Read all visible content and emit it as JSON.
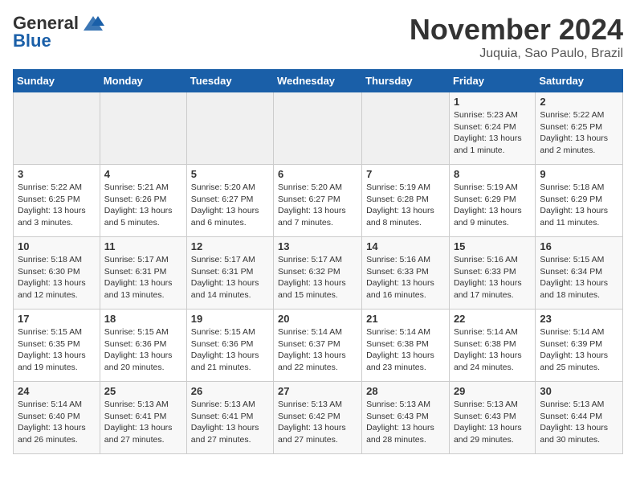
{
  "header": {
    "logo_general": "General",
    "logo_blue": "Blue",
    "month_title": "November 2024",
    "location": "Juquia, Sao Paulo, Brazil"
  },
  "days_of_week": [
    "Sunday",
    "Monday",
    "Tuesday",
    "Wednesday",
    "Thursday",
    "Friday",
    "Saturday"
  ],
  "weeks": [
    [
      {
        "day": "",
        "info": ""
      },
      {
        "day": "",
        "info": ""
      },
      {
        "day": "",
        "info": ""
      },
      {
        "day": "",
        "info": ""
      },
      {
        "day": "",
        "info": ""
      },
      {
        "day": "1",
        "info": "Sunrise: 5:23 AM\nSunset: 6:24 PM\nDaylight: 13 hours and 1 minute."
      },
      {
        "day": "2",
        "info": "Sunrise: 5:22 AM\nSunset: 6:25 PM\nDaylight: 13 hours and 2 minutes."
      }
    ],
    [
      {
        "day": "3",
        "info": "Sunrise: 5:22 AM\nSunset: 6:25 PM\nDaylight: 13 hours and 3 minutes."
      },
      {
        "day": "4",
        "info": "Sunrise: 5:21 AM\nSunset: 6:26 PM\nDaylight: 13 hours and 5 minutes."
      },
      {
        "day": "5",
        "info": "Sunrise: 5:20 AM\nSunset: 6:27 PM\nDaylight: 13 hours and 6 minutes."
      },
      {
        "day": "6",
        "info": "Sunrise: 5:20 AM\nSunset: 6:27 PM\nDaylight: 13 hours and 7 minutes."
      },
      {
        "day": "7",
        "info": "Sunrise: 5:19 AM\nSunset: 6:28 PM\nDaylight: 13 hours and 8 minutes."
      },
      {
        "day": "8",
        "info": "Sunrise: 5:19 AM\nSunset: 6:29 PM\nDaylight: 13 hours and 9 minutes."
      },
      {
        "day": "9",
        "info": "Sunrise: 5:18 AM\nSunset: 6:29 PM\nDaylight: 13 hours and 11 minutes."
      }
    ],
    [
      {
        "day": "10",
        "info": "Sunrise: 5:18 AM\nSunset: 6:30 PM\nDaylight: 13 hours and 12 minutes."
      },
      {
        "day": "11",
        "info": "Sunrise: 5:17 AM\nSunset: 6:31 PM\nDaylight: 13 hours and 13 minutes."
      },
      {
        "day": "12",
        "info": "Sunrise: 5:17 AM\nSunset: 6:31 PM\nDaylight: 13 hours and 14 minutes."
      },
      {
        "day": "13",
        "info": "Sunrise: 5:17 AM\nSunset: 6:32 PM\nDaylight: 13 hours and 15 minutes."
      },
      {
        "day": "14",
        "info": "Sunrise: 5:16 AM\nSunset: 6:33 PM\nDaylight: 13 hours and 16 minutes."
      },
      {
        "day": "15",
        "info": "Sunrise: 5:16 AM\nSunset: 6:33 PM\nDaylight: 13 hours and 17 minutes."
      },
      {
        "day": "16",
        "info": "Sunrise: 5:15 AM\nSunset: 6:34 PM\nDaylight: 13 hours and 18 minutes."
      }
    ],
    [
      {
        "day": "17",
        "info": "Sunrise: 5:15 AM\nSunset: 6:35 PM\nDaylight: 13 hours and 19 minutes."
      },
      {
        "day": "18",
        "info": "Sunrise: 5:15 AM\nSunset: 6:36 PM\nDaylight: 13 hours and 20 minutes."
      },
      {
        "day": "19",
        "info": "Sunrise: 5:15 AM\nSunset: 6:36 PM\nDaylight: 13 hours and 21 minutes."
      },
      {
        "day": "20",
        "info": "Sunrise: 5:14 AM\nSunset: 6:37 PM\nDaylight: 13 hours and 22 minutes."
      },
      {
        "day": "21",
        "info": "Sunrise: 5:14 AM\nSunset: 6:38 PM\nDaylight: 13 hours and 23 minutes."
      },
      {
        "day": "22",
        "info": "Sunrise: 5:14 AM\nSunset: 6:38 PM\nDaylight: 13 hours and 24 minutes."
      },
      {
        "day": "23",
        "info": "Sunrise: 5:14 AM\nSunset: 6:39 PM\nDaylight: 13 hours and 25 minutes."
      }
    ],
    [
      {
        "day": "24",
        "info": "Sunrise: 5:14 AM\nSunset: 6:40 PM\nDaylight: 13 hours and 26 minutes."
      },
      {
        "day": "25",
        "info": "Sunrise: 5:13 AM\nSunset: 6:41 PM\nDaylight: 13 hours and 27 minutes."
      },
      {
        "day": "26",
        "info": "Sunrise: 5:13 AM\nSunset: 6:41 PM\nDaylight: 13 hours and 27 minutes."
      },
      {
        "day": "27",
        "info": "Sunrise: 5:13 AM\nSunset: 6:42 PM\nDaylight: 13 hours and 27 minutes."
      },
      {
        "day": "28",
        "info": "Sunrise: 5:13 AM\nSunset: 6:43 PM\nDaylight: 13 hours and 28 minutes."
      },
      {
        "day": "29",
        "info": "Sunrise: 5:13 AM\nSunset: 6:43 PM\nDaylight: 13 hours and 29 minutes."
      },
      {
        "day": "30",
        "info": "Sunrise: 5:13 AM\nSunset: 6:44 PM\nDaylight: 13 hours and 30 minutes."
      }
    ]
  ]
}
